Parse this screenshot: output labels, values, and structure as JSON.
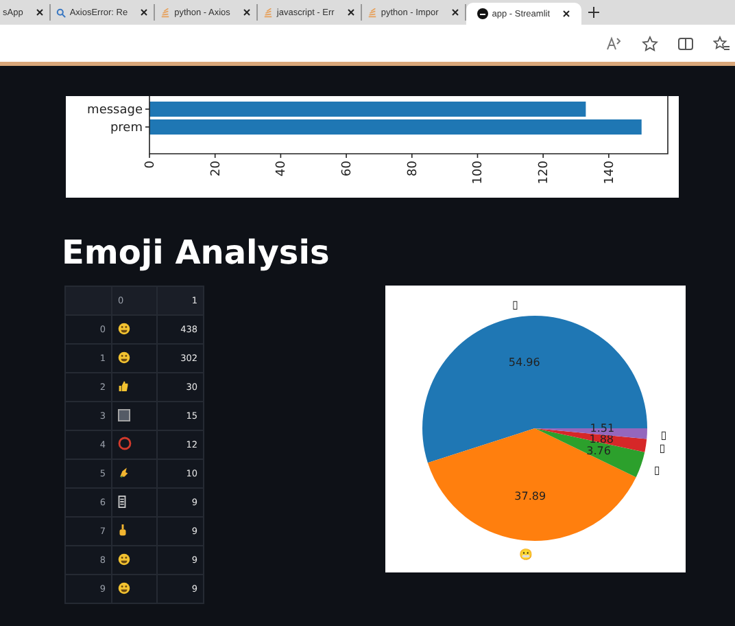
{
  "browser": {
    "tabs": [
      {
        "title": "sApp",
        "kind": "none",
        "selected": false
      },
      {
        "title": "AxiosError: Re",
        "kind": "search",
        "selected": false
      },
      {
        "title": "python - Axios",
        "kind": "stack",
        "selected": false
      },
      {
        "title": "javascript - Err",
        "kind": "stack",
        "selected": false
      },
      {
        "title": "python - Impor",
        "kind": "stack",
        "selected": false
      },
      {
        "title": "app - Streamlit",
        "kind": "app",
        "selected": true
      }
    ]
  },
  "bar_chart": {
    "chart_data": {
      "type": "bar",
      "orientation": "horizontal",
      "categories": [
        "message",
        "prem"
      ],
      "values": [
        133,
        150
      ],
      "xlim": [
        0,
        158
      ],
      "xticks": [
        0,
        20,
        40,
        60,
        80,
        100,
        120,
        140
      ],
      "color": "#1f77b4"
    }
  },
  "heading": "Emoji Analysis",
  "table": {
    "columns": [
      "0",
      "1"
    ],
    "rows": [
      {
        "index": "0",
        "kind": "face",
        "count": "438"
      },
      {
        "index": "1",
        "kind": "face",
        "count": "302"
      },
      {
        "index": "2",
        "kind": "thumb",
        "count": "30"
      },
      {
        "index": "3",
        "kind": "square",
        "count": "15"
      },
      {
        "index": "4",
        "kind": "ring",
        "count": "12"
      },
      {
        "index": "5",
        "kind": "hand",
        "count": "10"
      },
      {
        "index": "6",
        "kind": "box",
        "count": "9"
      },
      {
        "index": "7",
        "kind": "finger",
        "count": "9"
      },
      {
        "index": "8",
        "kind": "face",
        "count": "9"
      },
      {
        "index": "9",
        "kind": "face",
        "count": "9"
      }
    ]
  },
  "pie_chart": {
    "chart_data": {
      "type": "pie",
      "categories": [
        "▯",
        "😬",
        "▯",
        "▯",
        "▯"
      ],
      "values": [
        54.96,
        37.89,
        3.76,
        1.88,
        1.51
      ],
      "value_labels": [
        "54.96",
        "37.89",
        "3.76",
        "1.88",
        "1.51"
      ],
      "colors": [
        "#1f77b4",
        "#ff7f0e",
        "#2ca02c",
        "#d62728",
        "#9467bd"
      ]
    }
  }
}
